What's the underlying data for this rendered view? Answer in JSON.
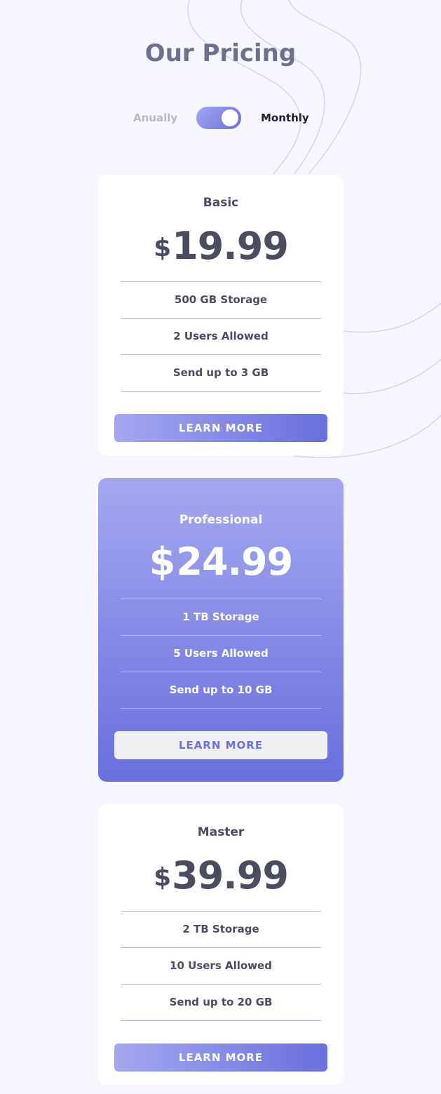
{
  "page": {
    "title": "Our Pricing"
  },
  "billing_toggle": {
    "annual_label": "Anually",
    "monthly_label": "Monthly",
    "selected": "Monthly"
  },
  "plans": [
    {
      "name": "Basic",
      "currency": "$",
      "price": "19.99",
      "features": [
        "500 GB Storage",
        "2 Users Allowed",
        "Send up to 3 GB"
      ],
      "button_label": "LEARN MORE"
    },
    {
      "name": "Professional",
      "currency": "$",
      "price": "24.99",
      "features": [
        "1 TB Storage",
        "5 Users Allowed",
        "Send up to 10 GB"
      ],
      "button_label": "LEARN MORE"
    },
    {
      "name": "Master",
      "currency": "$",
      "price": "39.99",
      "features": [
        "2 TB Storage",
        "10 Users Allowed",
        "Send up to 20 GB"
      ],
      "button_label": "LEARN MORE"
    }
  ],
  "colors": {
    "background": "#f6f6fe",
    "gradient_start": "#a3a8f0",
    "gradient_end": "#696fdd",
    "title_text": "#6d708d",
    "card_text": "#4a4d60"
  }
}
